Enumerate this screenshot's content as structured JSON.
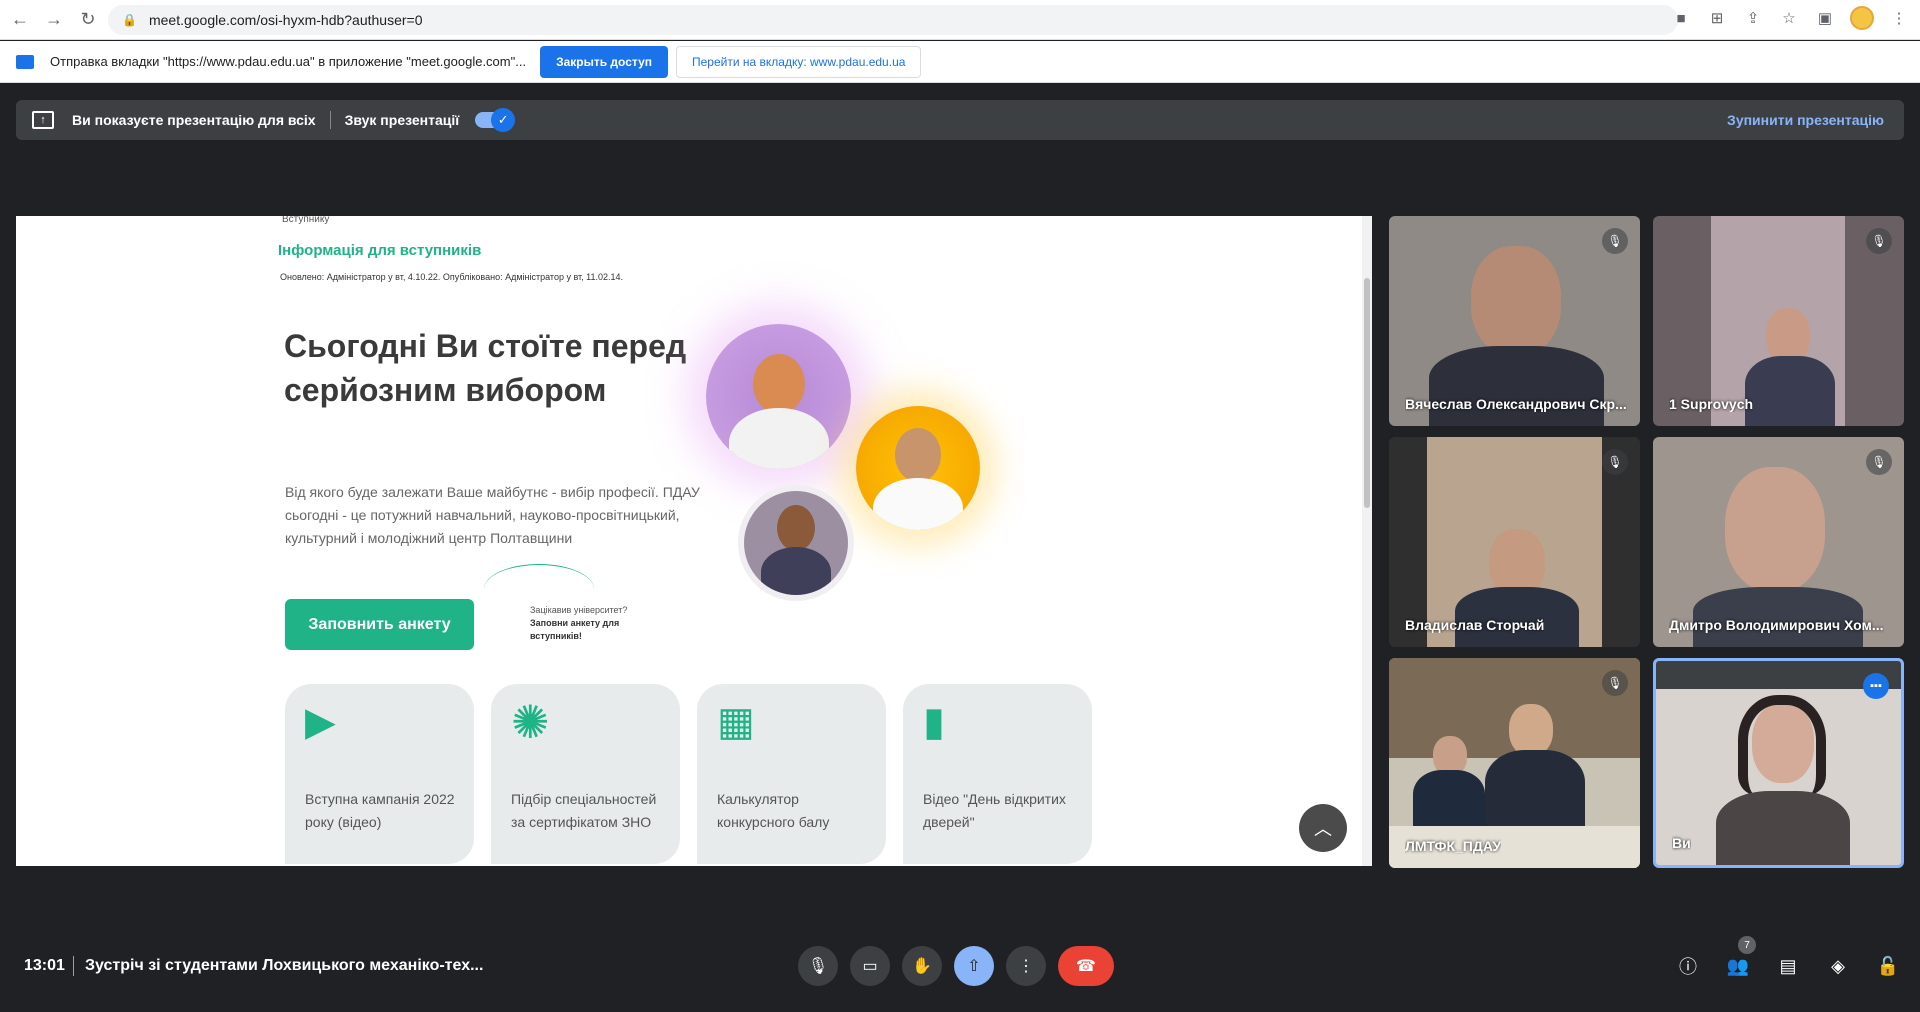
{
  "browser": {
    "url": "meet.google.com/osi-hyxm-hdb?authuser=0"
  },
  "infobar": {
    "text": "Отправка вкладки \"https://www.pdau.edu.ua\" в приложение \"meet.google.com\"...",
    "close_label": "Закрыть доступ",
    "switch_label": "Перейти на вкладку: www.pdau.edu.ua"
  },
  "presentation_bar": {
    "presenting_text": "Ви показуєте презентацію для всіх",
    "audio_label": "Звук презентації",
    "stop_label": "Зупинити презентацію"
  },
  "presented_page": {
    "breadcrumb": "Вступнику",
    "heading": "Інформація для вступників",
    "meta": "Оновлено: Адміністратор у вт, 4.10.22. Опубліковано: Адміністратор у вт, 11.02.14.",
    "hero_title": "Сьогодні Ви стоїте перед серйозним вибором",
    "hero_desc": "Від якого буде залежати Ваше майбутнє - вибір професії. ПДАУ сьогодні - це потужний навчальний, науково-просвітницький, культурний і молодіжний центр Полтавщини",
    "cta_label": "Заповнить анкету",
    "hint_question": "Зацікавив університет?",
    "hint_action": "Заповни анкету для вступників!",
    "cards": [
      {
        "label": "Вступна кампанія 2022 року (відео)",
        "icon": "play-icon"
      },
      {
        "label": "Підбір спеціальностей за сертифікатом ЗНО",
        "icon": "sun-icon"
      },
      {
        "label": "Калькулятор конкурсного балу",
        "icon": "calculator-icon"
      },
      {
        "label": "Відео \"День відкритих дверей\"",
        "icon": "door-icon"
      }
    ]
  },
  "participants": [
    {
      "name": "Вячеслав Олександрович Скр...",
      "muted": true
    },
    {
      "name": "1 Suprovych",
      "muted": true
    },
    {
      "name": "Владислав Сторчай",
      "muted": true
    },
    {
      "name": "Дмитро Володимирович Хом...",
      "muted": true
    },
    {
      "name": "ЛМТФК_ПДАУ",
      "muted": true
    },
    {
      "name": "Ви",
      "speaking": true
    }
  ],
  "bottom_bar": {
    "time": "13:01",
    "meeting_title": "Зустріч зі студентами Лохвицького механіко-тех...",
    "people_count": "7"
  },
  "colors": {
    "accent": "#1fb387",
    "meet_blue": "#8ab4f8",
    "hangup": "#ea4335"
  }
}
